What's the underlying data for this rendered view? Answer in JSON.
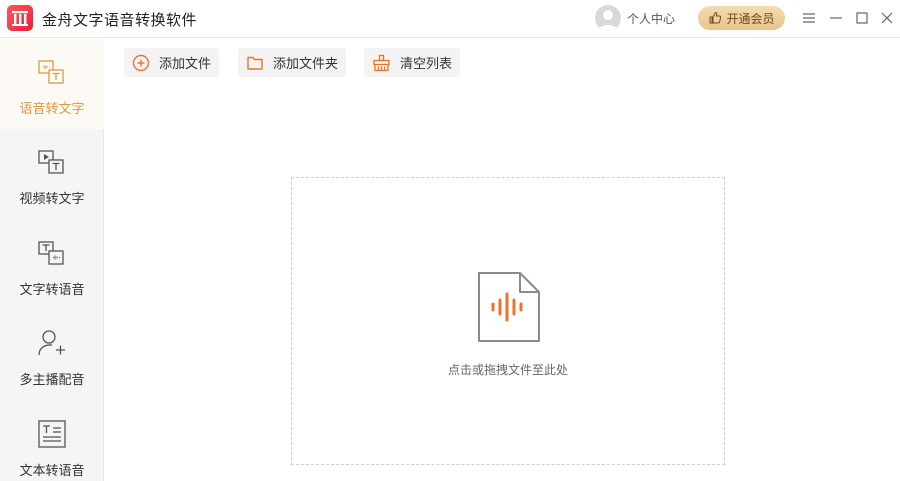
{
  "app": {
    "title": "金舟文字语音转换软件",
    "logo": "app-logo-icon"
  },
  "header": {
    "user_label": "个人中心",
    "vip_label": "开通会员"
  },
  "sidebar": {
    "items": [
      {
        "label": "语音转文字",
        "icon": "audio-to-text-icon",
        "active": true
      },
      {
        "label": "视频转文字",
        "icon": "video-to-text-icon",
        "active": false
      },
      {
        "label": "文字转语音",
        "icon": "text-to-audio-icon",
        "active": false
      },
      {
        "label": "多主播配音",
        "icon": "multi-voice-icon",
        "active": false
      },
      {
        "label": "文本转语音",
        "icon": "document-to-audio-icon",
        "active": false
      }
    ]
  },
  "toolbar": {
    "add_file": "添加文件",
    "add_folder": "添加文件夹",
    "clear_list": "清空列表"
  },
  "dropzone": {
    "hint": "点击或拖拽文件至此处"
  },
  "colors": {
    "accent": "#d99a45",
    "audio_wave": "#e8742f",
    "vip_text": "#6b4a1e"
  }
}
